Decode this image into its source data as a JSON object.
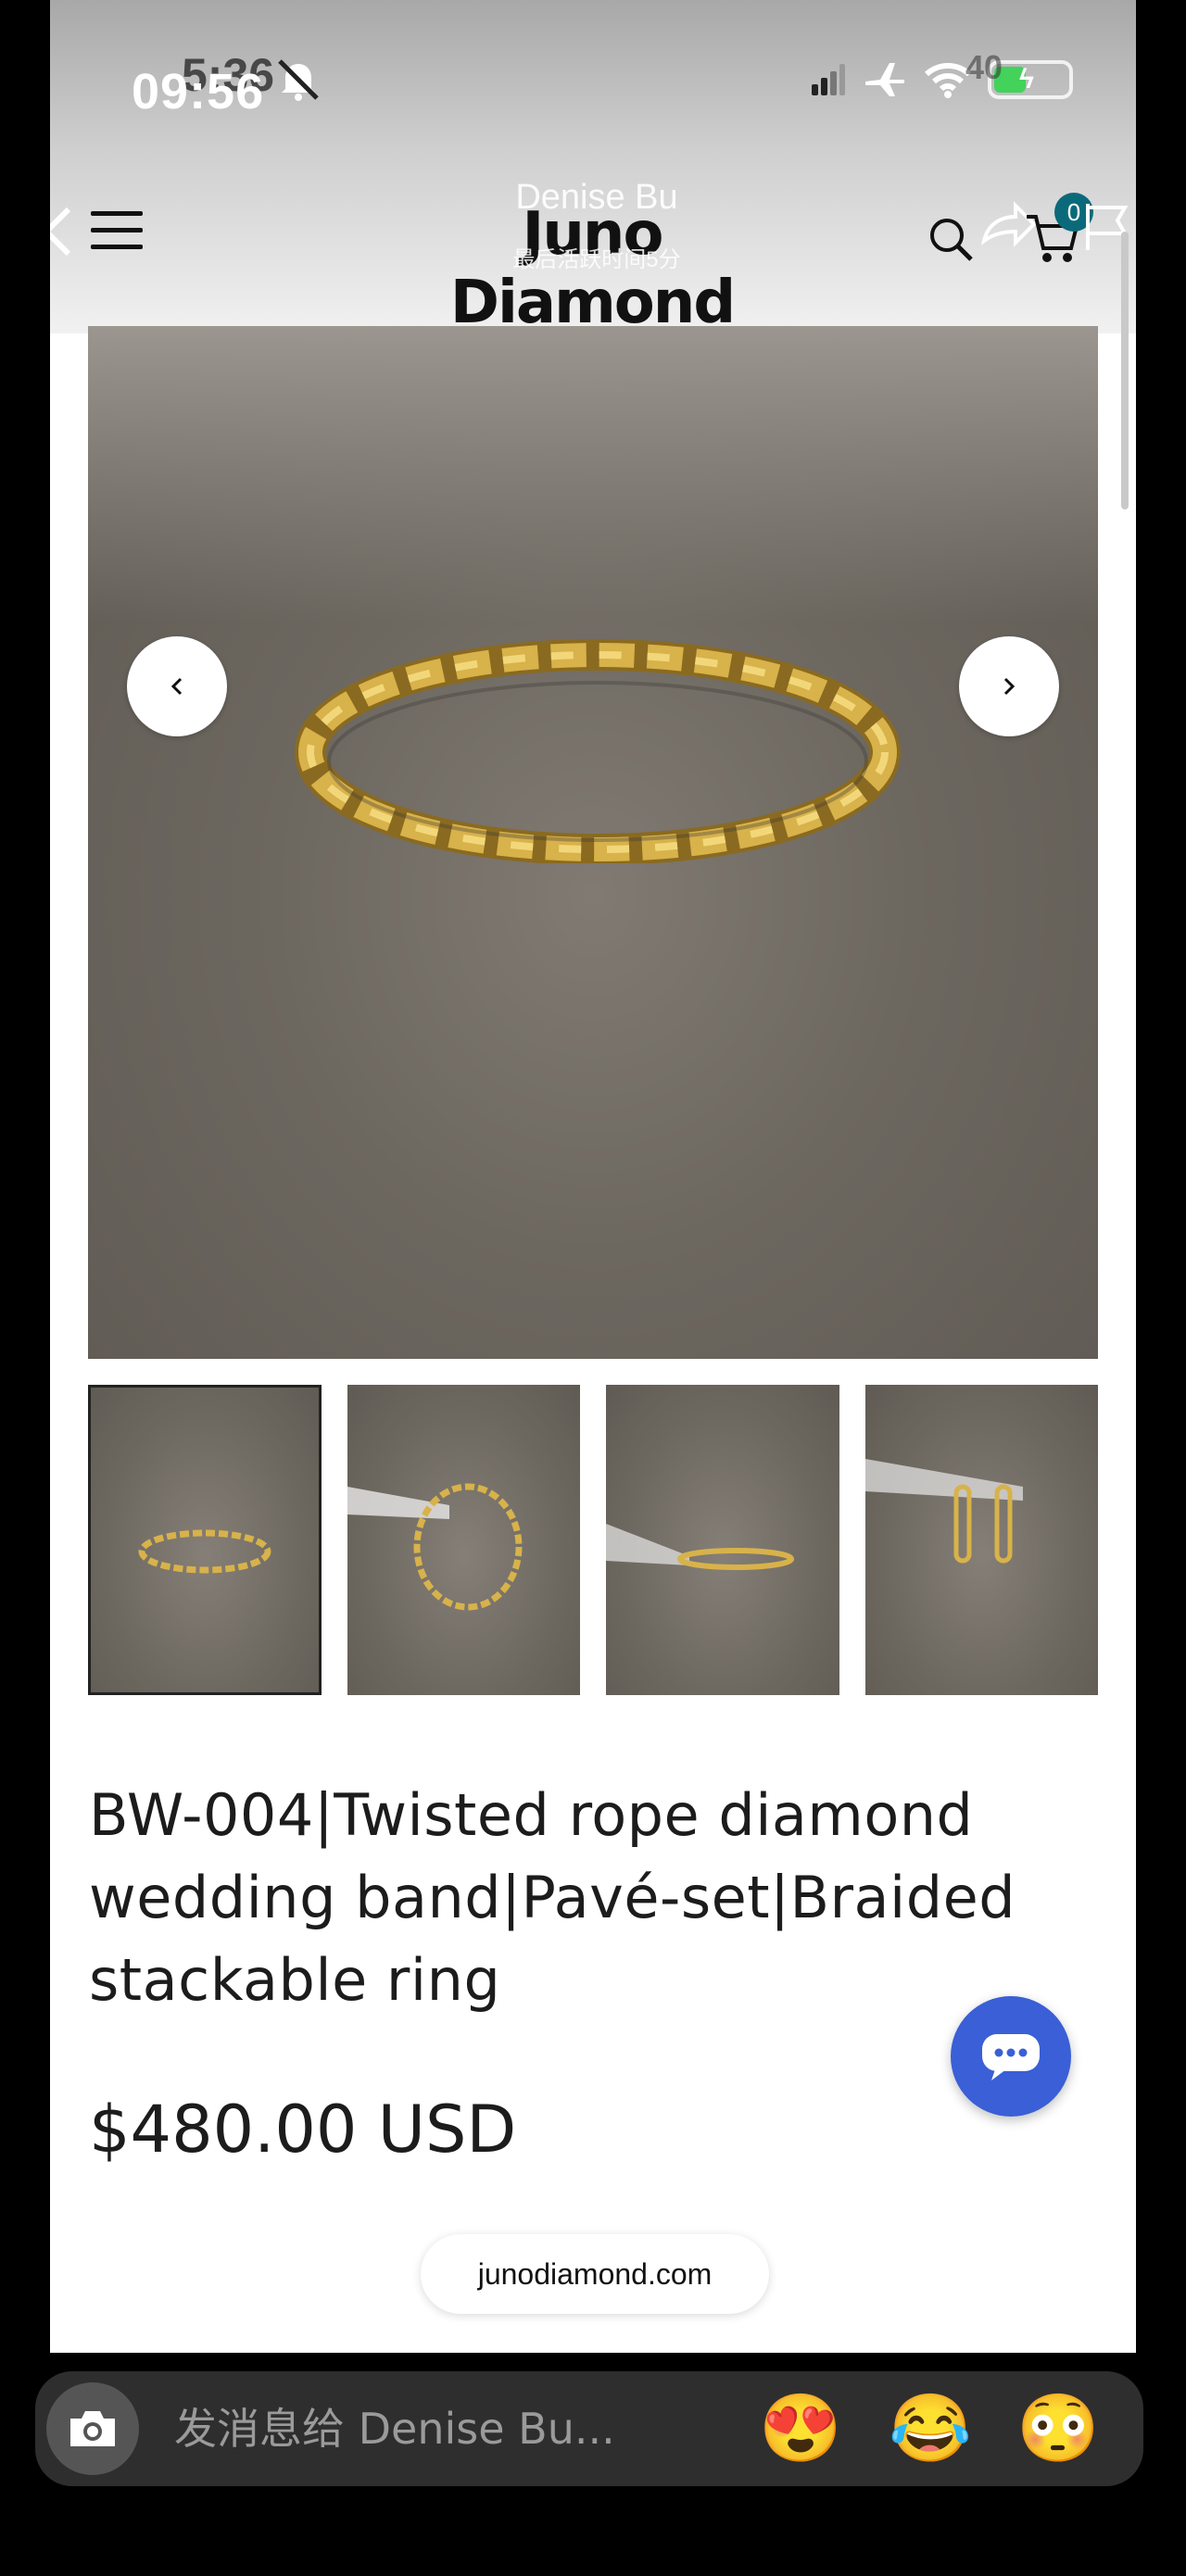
{
  "status_bar": {
    "time": "09:56",
    "time_behind": "5:36",
    "battery_level": "40"
  },
  "header": {
    "logo": "Juno Diamond",
    "overlay_name": "Denise Bu",
    "overlay_subtitle": "最后活跃时间5分",
    "cart_count": "0"
  },
  "product": {
    "title": "BW-004|Twisted rope diamond wedding band|Pavé-set|Braided stackable ring",
    "price": "$480.00 USD"
  },
  "domain_pill": "junodiamond.com",
  "message_bar": {
    "placeholder": "发消息给 Denise Bu...",
    "emojis": [
      "😍",
      "😂",
      "😳"
    ]
  },
  "icons": [
    "back-icon",
    "menu-icon",
    "search-icon",
    "share-icon",
    "cart-icon",
    "flag-icon",
    "chevron-left-icon",
    "chevron-right-icon",
    "chat-icon",
    "camera-icon"
  ],
  "colors": {
    "accent": "#3a5fd6",
    "cart_badge": "#0b6a7a",
    "ring_gold": "#d8b24a"
  }
}
